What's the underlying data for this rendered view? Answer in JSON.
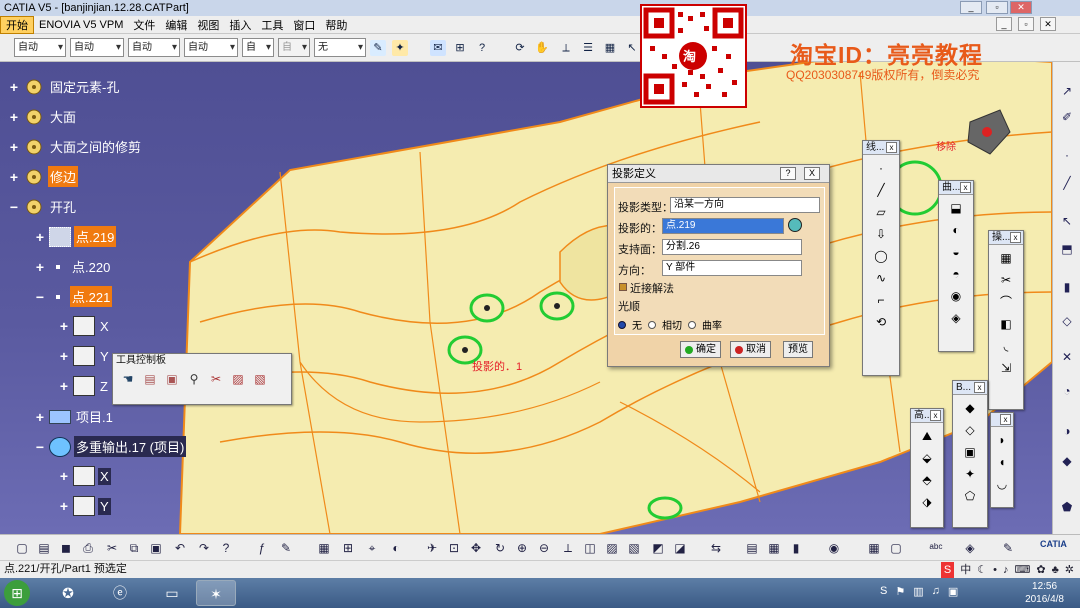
{
  "window": {
    "title": "CATIA V5 - [banjinjian.12.28.CATPart]"
  },
  "menu": {
    "items": [
      "开始",
      "ENOVIA V5 VPM",
      "文件",
      "编辑",
      "视图",
      "插入",
      "工具",
      "窗口",
      "帮助"
    ]
  },
  "toolbar": {
    "combos": [
      "自动",
      "自动",
      "自动",
      "自动",
      "自",
      "自",
      "无"
    ]
  },
  "tree": {
    "items": [
      {
        "label": "固定元素-孔"
      },
      {
        "label": "大面"
      },
      {
        "label": "大面之间的修剪"
      },
      {
        "label": "修边"
      },
      {
        "label": "开孔"
      },
      {
        "label": "点.219"
      },
      {
        "label": "点.220"
      },
      {
        "label": "点.221"
      },
      {
        "label": "X"
      },
      {
        "label": "Y"
      },
      {
        "label": "Z"
      },
      {
        "label": "项目.1"
      },
      {
        "label": "多重输出.17 (项目)"
      },
      {
        "label": "X"
      },
      {
        "label": "Y"
      }
    ]
  },
  "tools_panel": {
    "title": "工具控制板"
  },
  "viewport": {
    "annotation": "投影的．1",
    "corner_label": "移除"
  },
  "dialog": {
    "title": "投影定义",
    "help": "?",
    "close": "X",
    "projection_type_label": "投影类型：",
    "projection_type_value": "沿某一方向",
    "projected_label": "投影的：",
    "projected_value": "点.219",
    "support_label": "支持面：",
    "support_value": "分割.26",
    "direction_label": "方向：",
    "direction_value": "Y 部件",
    "nearest_label": "近接解法",
    "smooth_label": "光顺",
    "radio_none": "无",
    "radio_tangent": "相切",
    "radio_curvature": "曲率",
    "ok": "确定",
    "cancel": "取消",
    "preview": "预览"
  },
  "floating_toolbars": [
    {
      "title": "线..."
    },
    {
      "title": "曲..."
    },
    {
      "title": "操..."
    },
    {
      "title": "B..."
    },
    {
      "title": "高..."
    }
  ],
  "statusbar": {
    "text": "点.221/开孔/Part1 预选定",
    "ime": "中"
  },
  "taskbar": {
    "time": "12:56",
    "date": "2016/4/8"
  },
  "watermark": {
    "title": "淘宝ID：亮亮教程",
    "subtitle": "QQ2030308749版权所有，倒卖必究",
    "qr_badge": "淘"
  },
  "brand": "CATIA",
  "colors": {
    "highlight": "#f07a10",
    "surface": "#f5ecb0",
    "edge": "#f08a1a",
    "viewport_bg": "#5454a0"
  }
}
